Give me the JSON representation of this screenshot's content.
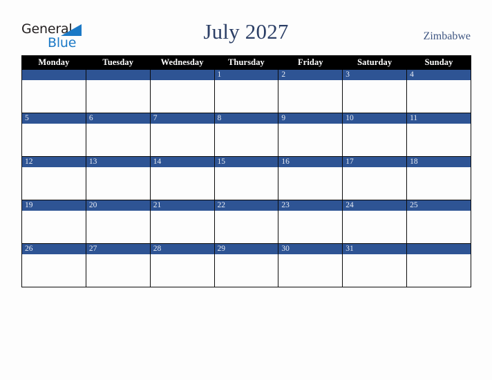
{
  "brand": {
    "line1": "General",
    "line2": "Blue",
    "triangle_color": "#1b79c6",
    "text_color": "#231f20"
  },
  "header": {
    "title": "July 2027",
    "month": "July",
    "year": "2027",
    "country": "Zimbabwe",
    "title_color": "#2c3f66",
    "country_color": "#3f5682"
  },
  "calendar": {
    "header_background": "#000000",
    "header_text_color": "#ffffff",
    "daybar_background": "#2e5494",
    "daybar_text_color": "#e8ecf4",
    "cell_background": "#fdfdfd",
    "border_color": "#0a0a0a",
    "weekday_headers": [
      "Monday",
      "Tuesday",
      "Wednesday",
      "Thursday",
      "Friday",
      "Saturday",
      "Sunday"
    ],
    "weeks": [
      [
        "",
        "",
        "",
        "1",
        "2",
        "3",
        "4"
      ],
      [
        "5",
        "6",
        "7",
        "8",
        "9",
        "10",
        "11"
      ],
      [
        "12",
        "13",
        "14",
        "15",
        "16",
        "17",
        "18"
      ],
      [
        "19",
        "20",
        "21",
        "22",
        "23",
        "24",
        "25"
      ],
      [
        "26",
        "27",
        "28",
        "29",
        "30",
        "31",
        ""
      ]
    ]
  }
}
